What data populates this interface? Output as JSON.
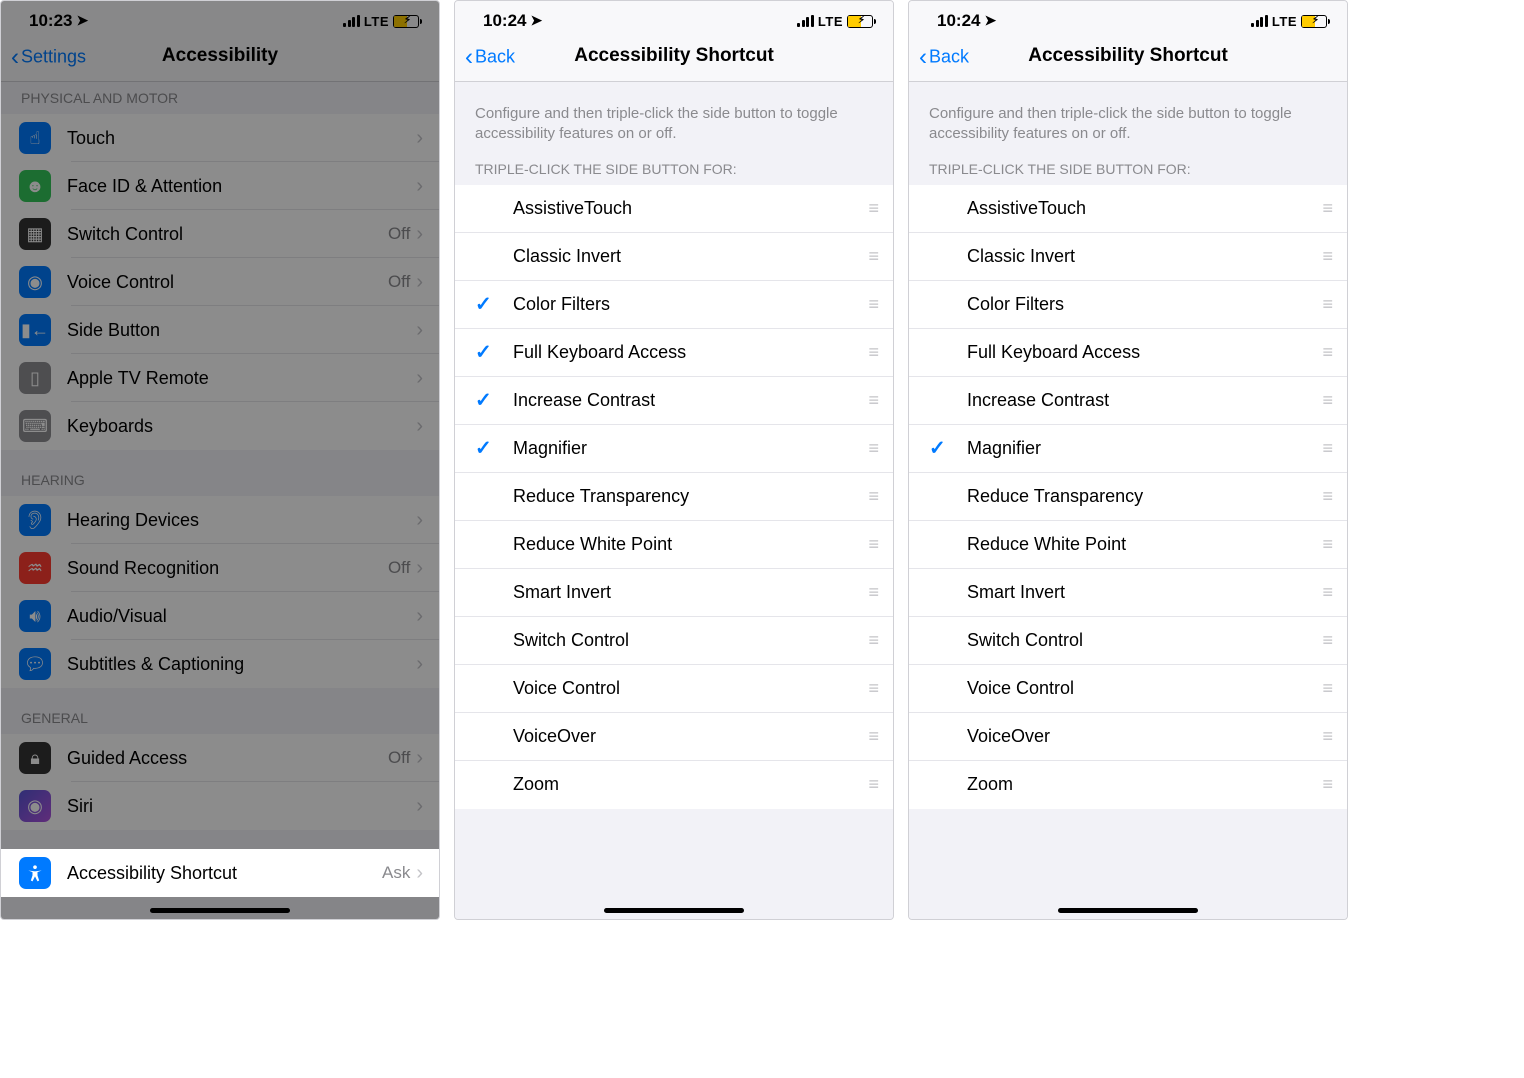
{
  "screens": [
    {
      "status_time": "10:23",
      "net": "LTE",
      "nav_back": "Settings",
      "nav_title": "Accessibility"
    },
    {
      "status_time": "10:24",
      "net": "LTE",
      "nav_back": "Back",
      "nav_title": "Accessibility Shortcut"
    },
    {
      "status_time": "10:24",
      "net": "LTE",
      "nav_back": "Back",
      "nav_title": "Accessibility Shortcut"
    }
  ],
  "s0": {
    "headers": {
      "physical": "PHYSICAL AND MOTOR",
      "hearing": "HEARING",
      "general": "GENERAL"
    },
    "rows": {
      "touch": "Touch",
      "faceid": "Face ID & Attention",
      "switch": "Switch Control",
      "voice": "Voice Control",
      "side": "Side Button",
      "appletv": "Apple TV Remote",
      "keyboards": "Keyboards",
      "hearing_dev": "Hearing Devices",
      "sound_rec": "Sound Recognition",
      "audio": "Audio/Visual",
      "subtitles": "Subtitles & Captioning",
      "guided": "Guided Access",
      "siri": "Siri",
      "shortcut": "Accessibility Shortcut"
    },
    "vals": {
      "off": "Off",
      "ask": "Ask"
    }
  },
  "shortcut": {
    "desc": "Configure and then triple-click the side button to toggle accessibility features on or off.",
    "header": "TRIPLE-CLICK THE SIDE BUTTON FOR:",
    "items": [
      "AssistiveTouch",
      "Classic Invert",
      "Color Filters",
      "Full Keyboard Access",
      "Increase Contrast",
      "Magnifier",
      "Reduce Transparency",
      "Reduce White Point",
      "Smart Invert",
      "Switch Control",
      "Voice Control",
      "VoiceOver",
      "Zoom"
    ],
    "checked_screen1": [
      2,
      3,
      4,
      5
    ],
    "checked_screen2": [
      5
    ]
  }
}
